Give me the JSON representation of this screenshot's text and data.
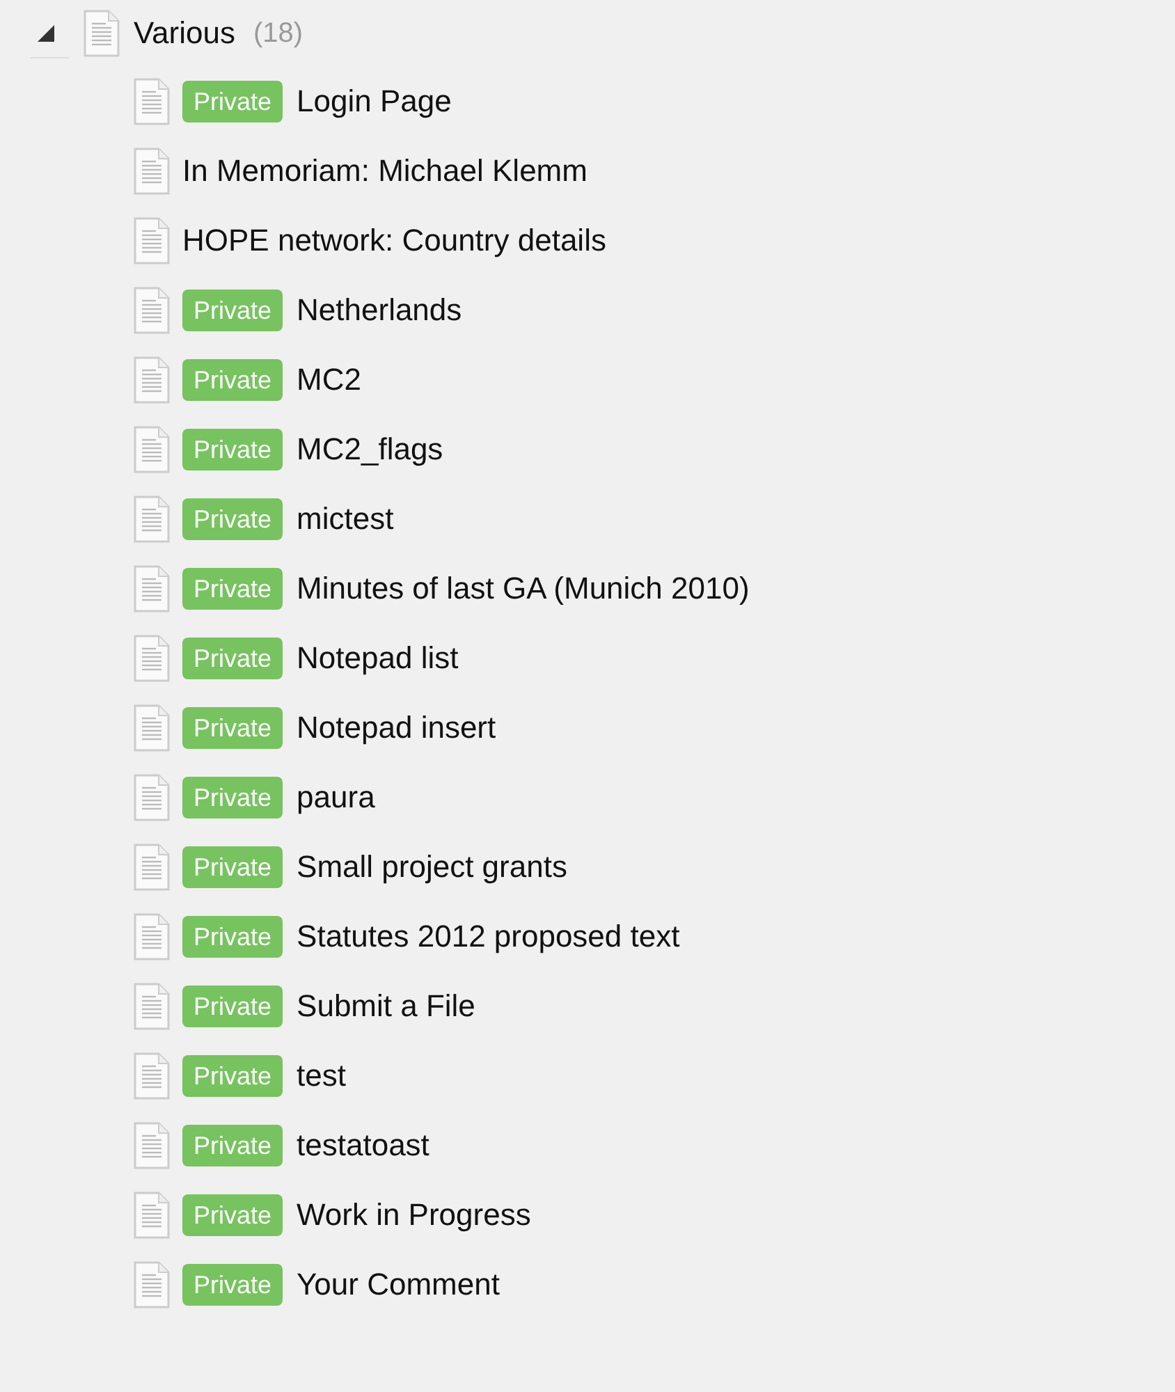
{
  "tree": {
    "label": "Various",
    "count": "(18)",
    "expanded": true,
    "children": [
      {
        "label": "Login Page",
        "tag": "Private"
      },
      {
        "label": "In Memoriam: Michael Klemm"
      },
      {
        "label": "HOPE network: Country details"
      },
      {
        "label": "Netherlands",
        "tag": "Private"
      },
      {
        "label": "MC2",
        "tag": "Private"
      },
      {
        "label": "MC2_flags",
        "tag": "Private"
      },
      {
        "label": "mictest",
        "tag": "Private"
      },
      {
        "label": "Minutes of last GA (Munich 2010)",
        "tag": "Private"
      },
      {
        "label": "Notepad list",
        "tag": "Private"
      },
      {
        "label": "Notepad insert",
        "tag": "Private"
      },
      {
        "label": "paura",
        "tag": "Private"
      },
      {
        "label": "Small project grants",
        "tag": "Private"
      },
      {
        "label": "Statutes 2012 proposed text",
        "tag": "Private"
      },
      {
        "label": "Submit a File",
        "tag": "Private"
      },
      {
        "label": "test",
        "tag": "Private"
      },
      {
        "label": "testatoast",
        "tag": "Private"
      },
      {
        "label": "Work in Progress",
        "tag": "Private"
      },
      {
        "label": "Your Comment",
        "tag": "Private"
      }
    ]
  }
}
